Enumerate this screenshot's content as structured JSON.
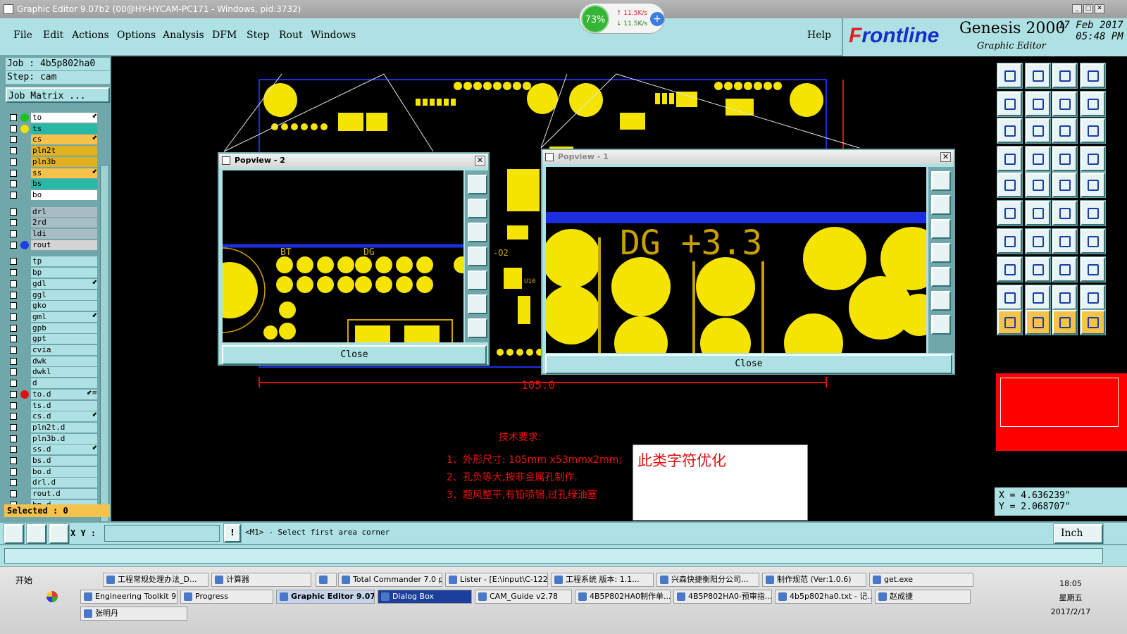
{
  "window": {
    "title": "Graphic Editor 9.07b2 (00@HY-HYCAM-PC171 - Windows, pid:3732)",
    "min": "_",
    "max": "□",
    "close": "✕"
  },
  "gadget": {
    "cpu": "73%",
    "up": "↑ 11.5K/s",
    "down": "↓ 11.5K/s",
    "plus": "+"
  },
  "menu": [
    "File",
    "Edit",
    "Actions",
    "Options",
    "Analysis",
    "DFM",
    "Step",
    "Rout",
    "Windows"
  ],
  "help": "Help",
  "brand": {
    "logo_a": "F",
    "logo_b": "r",
    "logo_c": "ontline",
    "product": "Genesis 2000",
    "editor": "Graphic Editor",
    "date": "17 Feb 2017",
    "time": "05:48 PM"
  },
  "job": "Job : 4b5p802ha0",
  "step": "Step: cam",
  "job_matrix": "Job Matrix ...",
  "layers": [
    {
      "name": "to",
      "color": "#ffffff",
      "dot": "#21c021",
      "mark": "⬋"
    },
    {
      "name": "ts",
      "color": "#28b8a6",
      "dot": "#f0e000",
      "mark": ""
    },
    {
      "name": "cs",
      "color": "#f6c24a",
      "dot": "",
      "mark": "⬋"
    },
    {
      "name": "pln2t",
      "color": "#e0b020",
      "dot": "",
      "mark": ""
    },
    {
      "name": "pln3b",
      "color": "#e0b020",
      "dot": "",
      "mark": ""
    },
    {
      "name": "ss",
      "color": "#f6c24a",
      "dot": "",
      "mark": "⬋"
    },
    {
      "name": "bs",
      "color": "#28b8a6",
      "dot": "",
      "mark": ""
    },
    {
      "name": "bo",
      "color": "#ffffff",
      "dot": "",
      "mark": ""
    },
    {
      "name": "drl",
      "color": "#a8bcc4",
      "dot": "",
      "mark": ""
    },
    {
      "name": "2rd",
      "color": "#a8bcc4",
      "dot": "",
      "mark": ""
    },
    {
      "name": "ldi",
      "color": "#a8bcc4",
      "dot": "",
      "mark": ""
    },
    {
      "name": "rout",
      "color": "#d4d4d4",
      "dot": "#1b3fe0",
      "mark": ""
    },
    {
      "name": "tp",
      "color": "#aee1e3",
      "dot": "",
      "mark": ""
    },
    {
      "name": "bp",
      "color": "#aee1e3",
      "dot": "",
      "mark": ""
    },
    {
      "name": "gdl",
      "color": "#aee1e3",
      "dot": "",
      "mark": "⬋"
    },
    {
      "name": "ggl",
      "color": "#aee1e3",
      "dot": "",
      "mark": ""
    },
    {
      "name": "gko",
      "color": "#aee1e3",
      "dot": "",
      "mark": ""
    },
    {
      "name": "gml",
      "color": "#aee1e3",
      "dot": "",
      "mark": "⬋"
    },
    {
      "name": "gpb",
      "color": "#aee1e3",
      "dot": "",
      "mark": ""
    },
    {
      "name": "gpt",
      "color": "#aee1e3",
      "dot": "",
      "mark": ""
    },
    {
      "name": "cvia",
      "color": "#aee1e3",
      "dot": "",
      "mark": ""
    },
    {
      "name": "dwk",
      "color": "#aee1e3",
      "dot": "",
      "mark": ""
    },
    {
      "name": "dwkl",
      "color": "#aee1e3",
      "dot": "",
      "mark": ""
    },
    {
      "name": "d",
      "color": "#aee1e3",
      "dot": "",
      "mark": ""
    },
    {
      "name": "to.d",
      "color": "#aee1e3",
      "dot": "#e01010",
      "mark": "⬋≡"
    },
    {
      "name": "ts.d",
      "color": "#aee1e3",
      "dot": "",
      "mark": ""
    },
    {
      "name": "cs.d",
      "color": "#aee1e3",
      "dot": "",
      "mark": "⬋"
    },
    {
      "name": "pln2t.d",
      "color": "#aee1e3",
      "dot": "",
      "mark": ""
    },
    {
      "name": "pln3b.d",
      "color": "#aee1e3",
      "dot": "",
      "mark": ""
    },
    {
      "name": "ss.d",
      "color": "#aee1e3",
      "dot": "",
      "mark": "⬋"
    },
    {
      "name": "bs.d",
      "color": "#aee1e3",
      "dot": "",
      "mark": ""
    },
    {
      "name": "bo.d",
      "color": "#aee1e3",
      "dot": "",
      "mark": ""
    },
    {
      "name": "drl.d",
      "color": "#aee1e3",
      "dot": "",
      "mark": ""
    },
    {
      "name": "rout.d",
      "color": "#aee1e3",
      "dot": "",
      "mark": ""
    },
    {
      "name": "bp.d",
      "color": "#aee1e3",
      "dot": "",
      "mark": ""
    }
  ],
  "selected": "Selected : 0",
  "popview2": {
    "title": "Popview - 2",
    "close": "Close",
    "labels": [
      "BT",
      "DG",
      "DG"
    ]
  },
  "popview1": {
    "title": "Popview - 1",
    "close": "Close",
    "label": "DG +3.3"
  },
  "board_labels": {
    "dim": "105.0",
    "o2": "-O2",
    "u10": "U10"
  },
  "notes": {
    "heading": "技术要求:",
    "line1": "1、外形尺寸: 105mm x53mmx2mm;",
    "line2": "2、孔负等大,按非金属孔制作.",
    "line3": "3、题风整平,有铅喷锡,过孔绿油塞"
  },
  "annotation": "此类字符优化",
  "coords": {
    "x": "X = 4.636239\"",
    "y": "Y = 2.068707\""
  },
  "cmd": {
    "xy": "X Y :",
    "prompt": "<M1> - Select first area corner",
    "units": "Inch"
  },
  "taskbar": {
    "start": "开始",
    "row1": [
      "工程常规处理办法_D...",
      "计算器",
      "",
      "Total Commander 7.0 p...",
      "Lister - [E:\\input\\C-122...",
      "工程系统  版本: 1.1...",
      "兴森快捷衡阳分公司...",
      "制作规范 (Ver:1.0.6)",
      "get.exe"
    ],
    "row2": [
      "Engineering Toolkit 9....",
      "Progress",
      "Graphic Editor 9.07...",
      "Dialog Box",
      "CAM_Guide v2.78",
      "4B5P802HA0制作单....",
      "4B5P802HA0-预审指...",
      "4b5p802ha0.txt - 记...",
      "赵成捷"
    ],
    "row3": [
      "张明丹"
    ],
    "time": "18:05",
    "weekday": "星期五",
    "date": "2017/2/17"
  }
}
